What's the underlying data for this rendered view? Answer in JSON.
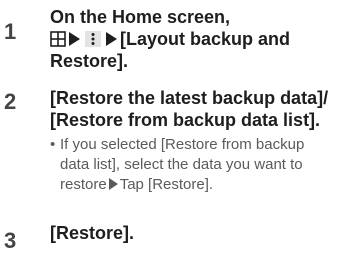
{
  "steps": [
    {
      "number": "1",
      "line1": "On the Home screen,",
      "line2_text": "[Layout backup and",
      "line3": "Restore]."
    },
    {
      "number": "2",
      "line1": "[Restore the latest backup data]/",
      "line2": "[Restore from backup data list].",
      "sub_bullet": "•",
      "sub_line1": "If you selected [Restore from backup",
      "sub_line2": "data list], select the data you want to",
      "sub_line3_text": "restore",
      "sub_line3_tail": "Tap [Restore]."
    },
    {
      "number": "3",
      "line1": "[Restore]."
    }
  ],
  "icons": {
    "apps": "apps-grid-icon",
    "arrow": "right-triangle-arrow-icon",
    "menu": "more-vertical-dots-icon"
  }
}
